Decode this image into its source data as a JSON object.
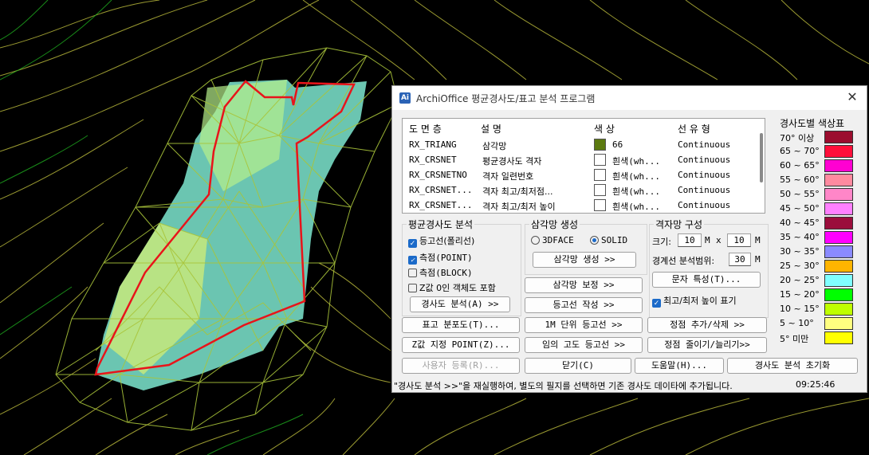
{
  "dialog": {
    "title": "ArchiOffice 평균경사도/표고 분석 프로그램",
    "icon": "archioffice-logo-icon",
    "close": "✕"
  },
  "layer_list": {
    "headers": [
      "도 면 층",
      "설 명",
      "색 상",
      "선 유 형"
    ],
    "rows": [
      {
        "layer": "RX_TRIANG",
        "desc": "삼각망",
        "color_name": "66",
        "color": "#5c7a10",
        "linetype": "Continuous"
      },
      {
        "layer": "RX_CRSNET",
        "desc": "평균경사도 격자",
        "color_name": "흰색(wh...",
        "color": "#ffffff",
        "linetype": "Continuous"
      },
      {
        "layer": "RX_CRSNETNO",
        "desc": "격자 일련번호",
        "color_name": "흰색(wh...",
        "color": "#ffffff",
        "linetype": "Continuous"
      },
      {
        "layer": "RX_CRSNET...",
        "desc": "격자 최고/최저점...",
        "color_name": "흰색(wh...",
        "color": "#ffffff",
        "linetype": "Continuous"
      },
      {
        "layer": "RX_CRSNET...",
        "desc": "격자 최고/최저 높이",
        "color_name": "흰색(wh...",
        "color": "#ffffff",
        "linetype": "Continuous"
      }
    ]
  },
  "slope_analysis": {
    "label": "평균경사도 분석",
    "contour": "등고선(폴리선)",
    "point": "측점(POINT)",
    "block": "측점(BLOCK)",
    "zero_z": "Z값 0인 객체도 포함",
    "contour_checked": true,
    "point_checked": true,
    "block_checked": false,
    "zero_z_checked": false,
    "analyze_btn": "경사도 분석(A) >>"
  },
  "tin": {
    "label": "삼각망 생성",
    "opt_3dface": "3DFACE",
    "opt_solid": "SOLID",
    "selected": "SOLID",
    "create_btn": "삼각망 생성 >>",
    "correct_btn": "삼각망 보정 >>",
    "contour_btn": "등고선 작성 >>"
  },
  "grid": {
    "label": "격자망 구성",
    "size_label": "크기:",
    "size_x": "10",
    "unit_m": "M",
    "times": "x",
    "size_y": "10",
    "boundary_label": "경계선 분석범위:",
    "boundary": "30",
    "text_btn": "문자 특성(T)...",
    "show_minmax": "최고/최저 높이 표기",
    "show_minmax_checked": true
  },
  "buttons": {
    "elev_map": "표고 분포도(T)...",
    "m1_contour": "1M 단위 등고선 >>",
    "add_del": "정점 추가/삭제 >>",
    "z_point": "Z값 지정 POINT(Z)...",
    "any_contour": "임의 고도 등고선 >>",
    "shrink": "정점 줄이기/늘리기>>",
    "register": "사용자 등록(R)...",
    "close": "닫기(C)",
    "help": "도움말(H)...",
    "reset": "경사도 분석 초기화"
  },
  "legend": {
    "title": "경사도별 색상표",
    "items": [
      {
        "label": "70° 이상",
        "color": "#9b0d2e"
      },
      {
        "label": "65 ~ 70°",
        "color": "#ff0f3a"
      },
      {
        "label": "60 ~ 65°",
        "color": "#ff00d2"
      },
      {
        "label": "55 ~ 60°",
        "color": "#ff8aa0"
      },
      {
        "label": "50 ~ 55°",
        "color": "#ff86c8"
      },
      {
        "label": "45 ~ 50°",
        "color": "#ff80ff"
      },
      {
        "label": "40 ~ 45°",
        "color": "#9b0d3c"
      },
      {
        "label": "35 ~ 40°",
        "color": "#ff00ff"
      },
      {
        "label": "30 ~ 35°",
        "color": "#8a8aff"
      },
      {
        "label": "25 ~ 30°",
        "color": "#ffb400"
      },
      {
        "label": "20 ~ 25°",
        "color": "#80ffff"
      },
      {
        "label": "15 ~ 20°",
        "color": "#00ff00"
      },
      {
        "label": "10 ~ 15°",
        "color": "#bfff00"
      },
      {
        "label": "5 ~ 10°",
        "color": "#ffff80"
      },
      {
        "label": "5° 미만",
        "color": "#ffff00"
      }
    ]
  },
  "status": {
    "message": "\"경사도 분석 >>\"을 재실행하여, 별도의 필지를 선택하면 기존 경사도 데이타에 추가됩니다.",
    "time": "09:25:46"
  }
}
